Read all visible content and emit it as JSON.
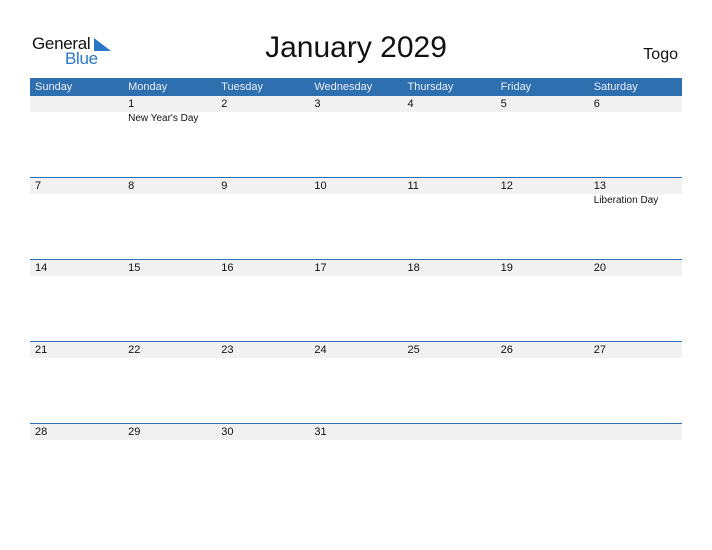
{
  "logo": {
    "word1": "General",
    "word2": "Blue"
  },
  "title": "January 2029",
  "country": "Togo",
  "colors": {
    "accent": "#2e6fb0",
    "logo_blue": "#2a78c5",
    "day_band": "#f1f1f1"
  },
  "weekdays": [
    "Sunday",
    "Monday",
    "Tuesday",
    "Wednesday",
    "Thursday",
    "Friday",
    "Saturday"
  ],
  "weeks": [
    [
      {
        "day": ""
      },
      {
        "day": "1",
        "event": "New Year's Day"
      },
      {
        "day": "2"
      },
      {
        "day": "3"
      },
      {
        "day": "4"
      },
      {
        "day": "5"
      },
      {
        "day": "6"
      }
    ],
    [
      {
        "day": "7"
      },
      {
        "day": "8"
      },
      {
        "day": "9"
      },
      {
        "day": "10"
      },
      {
        "day": "11"
      },
      {
        "day": "12"
      },
      {
        "day": "13",
        "event": "Liberation Day"
      }
    ],
    [
      {
        "day": "14"
      },
      {
        "day": "15"
      },
      {
        "day": "16"
      },
      {
        "day": "17"
      },
      {
        "day": "18"
      },
      {
        "day": "19"
      },
      {
        "day": "20"
      }
    ],
    [
      {
        "day": "21"
      },
      {
        "day": "22"
      },
      {
        "day": "23"
      },
      {
        "day": "24"
      },
      {
        "day": "25"
      },
      {
        "day": "26"
      },
      {
        "day": "27"
      }
    ],
    [
      {
        "day": "28"
      },
      {
        "day": "29"
      },
      {
        "day": "30"
      },
      {
        "day": "31"
      },
      {
        "day": ""
      },
      {
        "day": ""
      },
      {
        "day": ""
      }
    ]
  ]
}
